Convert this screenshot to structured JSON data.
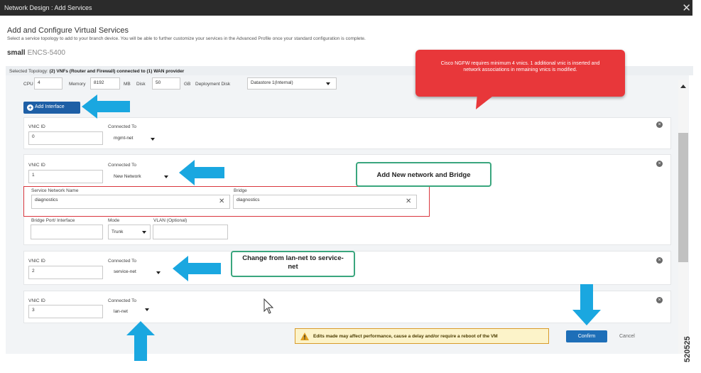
{
  "window": {
    "title": "Network Design : Add Services",
    "close_icon": "close-icon"
  },
  "header": {
    "title": "Add and Configure Virtual Services",
    "subtitle": "Select a service topology to add to your branch device. You will be able to further customize your services in the Advanced Profile once your standard configuration is complete.",
    "profile": "small",
    "device": "ENCS-5400"
  },
  "topology": {
    "prefix": "Selected Topology:",
    "value": "(2) VNFs (Router and Firewall) connected to (1) WAN provider"
  },
  "resources": {
    "cpu_label": "CPU",
    "cpu": "4",
    "memory_label": "Memory",
    "memory": "8192",
    "memory_unit": "MB",
    "disk_label": "Disk",
    "disk": "50",
    "disk_unit": "GB",
    "deploy_disk_label": "Deployment Disk",
    "deploy_disk": "Datastore 1(Internal)"
  },
  "add_interface_label": "Add Interface",
  "labels": {
    "vnic_id": "VNIC ID",
    "connected_to": "Connected To",
    "service_network_name": "Service Network Name",
    "bridge": "Bridge",
    "bridge_port": "Bridge Port/ Interface",
    "mode": "Mode",
    "vlan": "VLAN (Optional)"
  },
  "vnics": [
    {
      "id": "0",
      "network": "mgmt-net"
    },
    {
      "id": "1",
      "network": "New Network",
      "service_network_name": "diagnostics",
      "bridge": "diagnostics",
      "mode": "Trunk",
      "vlan": ""
    },
    {
      "id": "2",
      "network": "service-net"
    },
    {
      "id": "3",
      "network": "lan-net"
    }
  ],
  "annotations": {
    "ngfw_callout": "Cisco NGFW requires minimum 4 vnics. 1 additional vnic is inserted and network associations in remaining vnics is modified.",
    "add_network": "Add New network and Bridge",
    "change_net": "Change from lan-net to service-net"
  },
  "warning": "Edits made may affect performance, cause a delay and/or require a reboot of the VM",
  "actions": {
    "confirm": "Confirm",
    "cancel": "Cancel"
  },
  "figure_id": "520525",
  "colors": {
    "accent": "#1e6fb8",
    "arrow": "#1aa7e0",
    "callout": "#e8373a",
    "annotation_border": "#3aa67e",
    "highlight_border": "#d9363e"
  }
}
